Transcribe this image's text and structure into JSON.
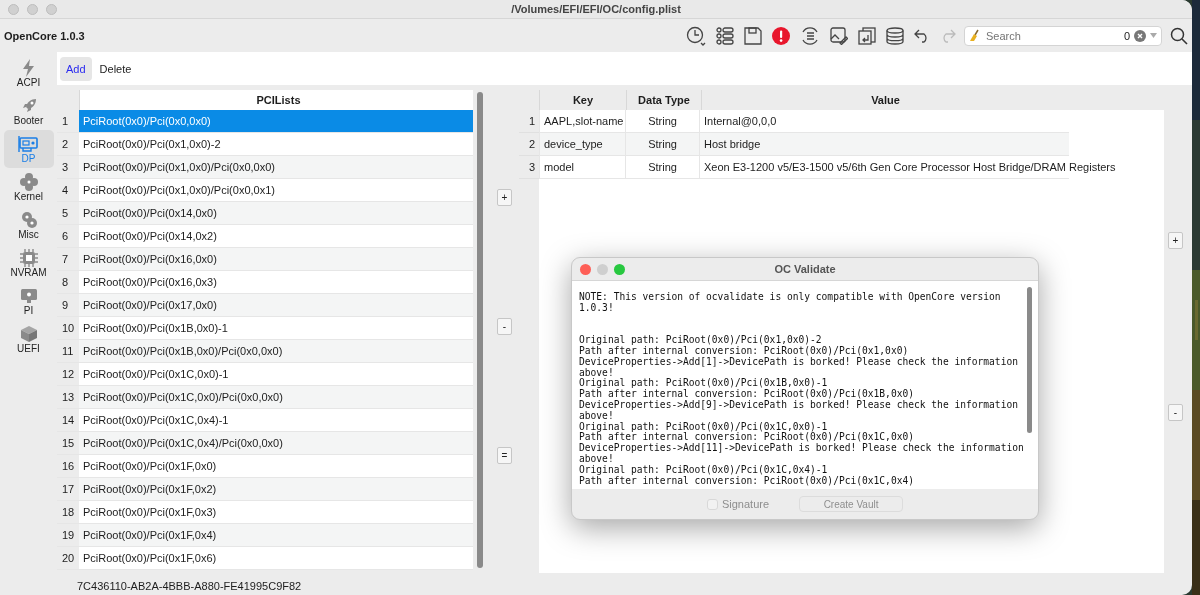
{
  "window": {
    "title": "/Volumes/EFI/EFI/OC/config.plist"
  },
  "toolbar": {
    "app_name": "OpenCore 1.0.3",
    "search": {
      "placeholder": "Search",
      "count": "0"
    }
  },
  "sidebar": {
    "items": [
      {
        "label": "ACPI",
        "selected": false
      },
      {
        "label": "Booter",
        "selected": false
      },
      {
        "label": "DP",
        "selected": true
      },
      {
        "label": "Kernel",
        "selected": false
      },
      {
        "label": "Misc",
        "selected": false
      },
      {
        "label": "NVRAM",
        "selected": false
      },
      {
        "label": "PI",
        "selected": false
      },
      {
        "label": "UEFI",
        "selected": false
      }
    ]
  },
  "subtabs": [
    {
      "label": "Add",
      "selected": true
    },
    {
      "label": "Delete",
      "selected": false
    }
  ],
  "pci_list": {
    "column": "PCILists",
    "rows": [
      {
        "index": "1",
        "path": "PciRoot(0x0)/Pci(0x0,0x0)",
        "selected": true
      },
      {
        "index": "2",
        "path": "PciRoot(0x0)/Pci(0x1,0x0)-2",
        "selected": false
      },
      {
        "index": "3",
        "path": "PciRoot(0x0)/Pci(0x1,0x0)/Pci(0x0,0x0)",
        "selected": false
      },
      {
        "index": "4",
        "path": "PciRoot(0x0)/Pci(0x1,0x0)/Pci(0x0,0x1)",
        "selected": false
      },
      {
        "index": "5",
        "path": "PciRoot(0x0)/Pci(0x14,0x0)",
        "selected": false
      },
      {
        "index": "6",
        "path": "PciRoot(0x0)/Pci(0x14,0x2)",
        "selected": false
      },
      {
        "index": "7",
        "path": "PciRoot(0x0)/Pci(0x16,0x0)",
        "selected": false
      },
      {
        "index": "8",
        "path": "PciRoot(0x0)/Pci(0x16,0x3)",
        "selected": false
      },
      {
        "index": "9",
        "path": "PciRoot(0x0)/Pci(0x17,0x0)",
        "selected": false
      },
      {
        "index": "10",
        "path": "PciRoot(0x0)/Pci(0x1B,0x0)-1",
        "selected": false
      },
      {
        "index": "11",
        "path": "PciRoot(0x0)/Pci(0x1B,0x0)/Pci(0x0,0x0)",
        "selected": false
      },
      {
        "index": "12",
        "path": "PciRoot(0x0)/Pci(0x1C,0x0)-1",
        "selected": false
      },
      {
        "index": "13",
        "path": "PciRoot(0x0)/Pci(0x1C,0x0)/Pci(0x0,0x0)",
        "selected": false
      },
      {
        "index": "14",
        "path": "PciRoot(0x0)/Pci(0x1C,0x4)-1",
        "selected": false
      },
      {
        "index": "15",
        "path": "PciRoot(0x0)/Pci(0x1C,0x4)/Pci(0x0,0x0)",
        "selected": false
      },
      {
        "index": "16",
        "path": "PciRoot(0x0)/Pci(0x1F,0x0)",
        "selected": false
      },
      {
        "index": "17",
        "path": "PciRoot(0x0)/Pci(0x1F,0x2)",
        "selected": false
      },
      {
        "index": "18",
        "path": "PciRoot(0x0)/Pci(0x1F,0x3)",
        "selected": false
      },
      {
        "index": "19",
        "path": "PciRoot(0x0)/Pci(0x1F,0x4)",
        "selected": false
      },
      {
        "index": "20",
        "path": "PciRoot(0x0)/Pci(0x1F,0x6)",
        "selected": false
      }
    ]
  },
  "middle_buttons": [
    "+",
    "-",
    "="
  ],
  "properties": {
    "columns": [
      "Key",
      "Data Type",
      "Value"
    ],
    "rows": [
      {
        "index": "1",
        "key": "AAPL,slot-name",
        "type": "String",
        "value": "Internal@0,0,0"
      },
      {
        "index": "2",
        "key": "device_type",
        "type": "String",
        "value": "Host bridge"
      },
      {
        "index": "3",
        "key": "model",
        "type": "String",
        "value": "Xeon E3-1200 v5/E3-1500 v5/6th Gen Core Processor Host Bridge/DRAM Registers"
      }
    ]
  },
  "right_buttons": [
    "+",
    "-"
  ],
  "status_bar": {
    "text": "7C436110-AB2A-4BBB-A880-FE41995C9F82"
  },
  "dialog": {
    "title": "OC Validate",
    "note": [
      "NOTE: This version of ocvalidate is only compatible with OpenCore version",
      "1.0.3!"
    ],
    "log": [
      "Original path: PciRoot(0x0)/Pci(0x1,0x0)-2",
      "Path after internal conversion: PciRoot(0x0)/Pci(0x1,0x0)",
      "DeviceProperties->Add[1]->DevicePath is borked! Please check the information",
      "above!",
      "Original path: PciRoot(0x0)/Pci(0x1B,0x0)-1",
      "Path after internal conversion: PciRoot(0x0)/Pci(0x1B,0x0)",
      "DeviceProperties->Add[9]->DevicePath is borked! Please check the information",
      "above!",
      "Original path: PciRoot(0x0)/Pci(0x1C,0x0)-1",
      "Path after internal conversion: PciRoot(0x0)/Pci(0x1C,0x0)",
      "DeviceProperties->Add[11]->DevicePath is borked! Please check the information",
      "above!",
      "Original path: PciRoot(0x0)/Pci(0x1C,0x4)-1",
      "Path after internal conversion: PciRoot(0x0)/Pci(0x1C,0x4)"
    ],
    "signature": {
      "label": "Signature",
      "checked": false,
      "disabled": true
    },
    "vault_button": {
      "label": "Create Vault",
      "disabled": true
    }
  }
}
